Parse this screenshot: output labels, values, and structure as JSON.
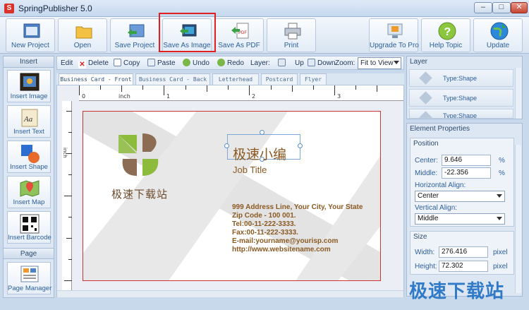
{
  "window": {
    "title": "SpringPublisher 5.0",
    "controls": [
      "–",
      "□",
      "✕"
    ]
  },
  "toolbar": {
    "buttons": [
      {
        "label": "New Project",
        "icon": "new-project-icon"
      },
      {
        "label": "Open",
        "icon": "folder-icon"
      },
      {
        "label": "Save Project",
        "icon": "save-project-icon"
      },
      {
        "label": "Save As Image",
        "icon": "save-image-icon"
      },
      {
        "label": "Save As PDF",
        "icon": "pdf-icon"
      },
      {
        "label": "Print",
        "icon": "printer-icon"
      },
      {
        "label": "Upgrade To Pro",
        "icon": "upgrade-icon"
      },
      {
        "label": "Help Topic",
        "icon": "help-icon"
      },
      {
        "label": "Update",
        "icon": "globe-update-icon"
      }
    ]
  },
  "left_panel": {
    "insert_header": "Insert",
    "items": [
      {
        "label": "Insert Image",
        "icon": "image-icon"
      },
      {
        "label": "Insert Text",
        "icon": "text-icon"
      },
      {
        "label": "Insert Shape",
        "icon": "shape-icon"
      },
      {
        "label": "Insert Map",
        "icon": "map-icon"
      },
      {
        "label": "Insert Barcode",
        "icon": "barcode-icon"
      }
    ],
    "page_header": "Page",
    "page_manager": {
      "label": "Page Manager",
      "icon": "page-manager-icon"
    }
  },
  "editbar": {
    "edit_label": "Edit",
    "delete": "Delete",
    "copy": "Copy",
    "paste": "Paste",
    "undo": "Undo",
    "redo": "Redo",
    "layer_label": "Layer:",
    "up": "Up",
    "down": "Down",
    "zoom_label": "Zoom:",
    "zoom_value": "Fit to View"
  },
  "tabs": [
    "Business Card - Front",
    "Business Card - Back",
    "Letterhead",
    "Postcard",
    "Flyer"
  ],
  "ruler": {
    "unit": "inch",
    "h_labels": [
      "0",
      "1",
      "2",
      "3"
    ],
    "v_label": "inch"
  },
  "card": {
    "logo_text": "极速下载站",
    "name": "极速小编",
    "job_title": "Job Title",
    "address_lines": [
      "999 Address Line, Your City, Your State",
      "Zip Code - 100 001.",
      "Tel:00-11-222-3333.",
      "Fax:00-11-222-3333.",
      "E-mail:yourname@yourisp.com",
      "http://www.websitename.com"
    ],
    "colors": {
      "text": "#8b5a22",
      "logo_green": "#8dbb3d",
      "logo_brown": "#8c6d53",
      "border": "#cc3333"
    }
  },
  "layer_panel": {
    "title": "Layer",
    "items": [
      "Type:Shape",
      "Type:Shape",
      "Type:Shape"
    ]
  },
  "element_properties": {
    "title": "Element Properties",
    "position": {
      "title": "Position",
      "center_label": "Center:",
      "center_value": "9.646",
      "center_unit": "%",
      "middle_label": "Middle:",
      "middle_value": "-22.356",
      "middle_unit": "%",
      "h_align_label": "Horizontal Align:",
      "h_align_value": "Center",
      "v_align_label": "Vertical Align:",
      "v_align_value": "Middle"
    },
    "size": {
      "title": "Size",
      "width_label": "Width:",
      "width_value": "276.416",
      "width_unit": "pixel",
      "height_label": "Height:",
      "height_value": "72.302",
      "height_unit": "pixel"
    }
  },
  "watermark": "极速下载站"
}
